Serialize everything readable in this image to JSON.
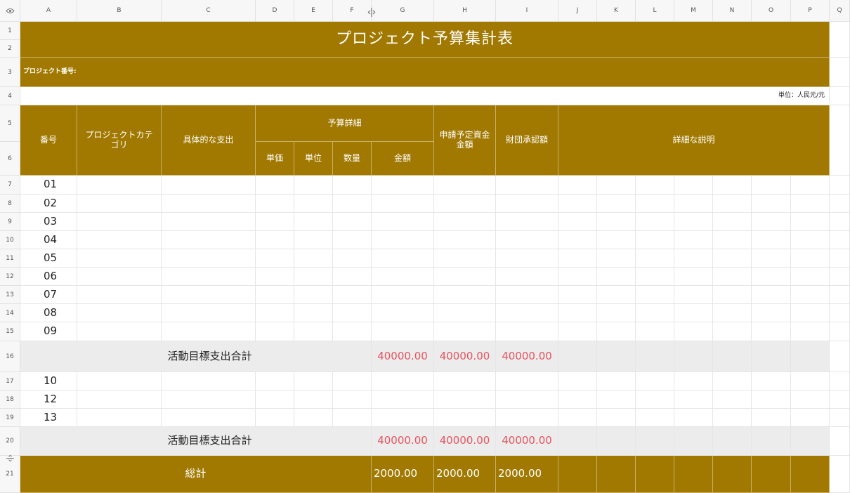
{
  "columns": [
    "A",
    "B",
    "C",
    "D",
    "E",
    "F",
    "G",
    "H",
    "I",
    "J",
    "K",
    "L",
    "M",
    "N",
    "O",
    "P",
    "Q"
  ],
  "rows": [
    "1",
    "2",
    "3",
    "4",
    "5",
    "6",
    "7",
    "8",
    "9",
    "10",
    "11",
    "12",
    "13",
    "14",
    "15",
    "16",
    "17",
    "18",
    "19",
    "20",
    "21"
  ],
  "title": "プロジェクト予算集計表",
  "project_number_label": "プロジェクト番号:",
  "unit_label": "単位：人民元/元",
  "headers": {
    "number": "番号",
    "category": "プロジェクトカテ\nゴリ",
    "expense": "具体的な支出",
    "budget_detail": "予算詳細",
    "unit_price": "単価",
    "unit": "単位",
    "quantity": "数量",
    "amount": "金額",
    "requested_fund": "申請予定資金\n金額",
    "foundation_approved": "財団承認額",
    "description": "詳細な説明"
  },
  "items_group1": [
    "01",
    "02",
    "03",
    "04",
    "05",
    "06",
    "07",
    "08",
    "09"
  ],
  "subtotal1": {
    "label": "活動目標支出合計",
    "amount": "40000.00",
    "requested": "40000.00",
    "approved": "40000.00"
  },
  "items_group2": [
    "10",
    "12",
    "13"
  ],
  "subtotal2": {
    "label": "活動目標支出合計",
    "amount": "40000.00",
    "requested": "40000.00",
    "approved": "40000.00"
  },
  "total": {
    "label": "総計",
    "amount": "2000.00",
    "requested": "2000.00",
    "approved": "2000.00"
  },
  "colors": {
    "header_gold": "#a17901",
    "subtotal_gray": "#ececec",
    "subtotal_red": "#e8535f"
  }
}
